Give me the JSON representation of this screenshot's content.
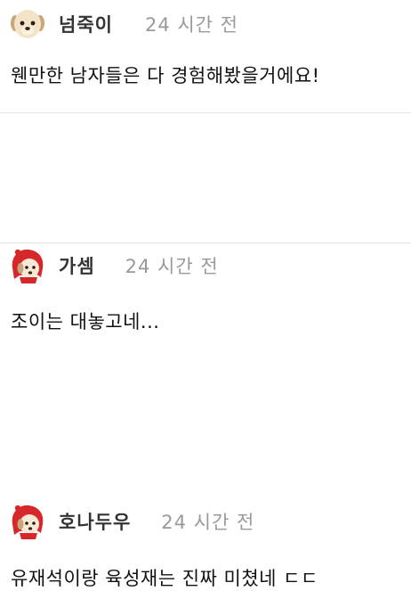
{
  "comments": [
    {
      "nickname": "넘죽이",
      "time": "24 시간 전",
      "text": "웬만한 남자들은 다 경험해봤을거에요!",
      "avatar_icon": "puppy-face-icon"
    },
    {
      "nickname": "가셈",
      "time": "24 시간 전",
      "text": "조이는 대놓고네...",
      "avatar_icon": "puppy-red-hood-icon"
    },
    {
      "nickname": "호나두우",
      "time": "24 시간 전",
      "text": "유재석이랑 육성재는 진짜 미쳤네 ㄷㄷ",
      "avatar_icon": "puppy-red-hood-icon"
    }
  ],
  "colors": {
    "nickname": "#333333",
    "time": "#9a9a9a",
    "text": "#111111",
    "divider": "#e4e4e4",
    "hood_red": "#d6282b"
  }
}
